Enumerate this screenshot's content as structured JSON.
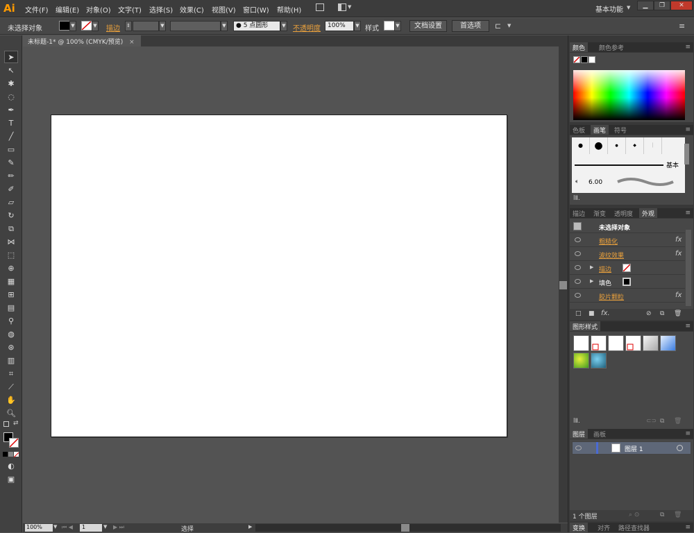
{
  "app": {
    "logo": "Ai",
    "workspace": "基本功能"
  },
  "menu": [
    "文件(F)",
    "编辑(E)",
    "对象(O)",
    "文字(T)",
    "选择(S)",
    "效果(C)",
    "视图(V)",
    "窗口(W)",
    "帮助(H)"
  ],
  "control_bar": {
    "selection_status": "未选择对象",
    "stroke_label": "描边",
    "brush_value": "● 5 点圆形",
    "opacity_label": "不透明度",
    "opacity_value": "100%",
    "style_label": "样式",
    "doc_setup_button": "文档设置",
    "preferences_button": "首选项"
  },
  "document": {
    "tab_title": "未标题-1* @ 100% (CMYK/预览)",
    "close_glyph": "×"
  },
  "status_bar": {
    "zoom": "100%",
    "artboard_num": "1",
    "tool_status": "选择"
  },
  "panels": {
    "color": {
      "tabs": [
        "颜色",
        "颜色参考"
      ]
    },
    "brushes": {
      "tabs": [
        "色板",
        "画笔",
        "符号"
      ],
      "basic_label": "基本",
      "brush_size": "6.00"
    },
    "appearance": {
      "tabs": [
        "描边",
        "渐变",
        "透明度",
        "外观"
      ],
      "title": "未选择对象",
      "rows": [
        {
          "label": "粗糙化",
          "fx": "fx"
        },
        {
          "label": "波纹效果",
          "fx": "fx"
        },
        {
          "label": "描边",
          "fx": ""
        },
        {
          "label": "填色",
          "fx": ""
        },
        {
          "label": "胶片颗粒",
          "fx": "fx"
        }
      ]
    },
    "graphic_styles": {
      "tabs": [
        "图形样式"
      ]
    },
    "layers": {
      "tabs": [
        "图层",
        "画板"
      ],
      "layer_name": "图层 1",
      "layer_count": "1 个图层"
    },
    "bottom": {
      "tabs": [
        "变换",
        "对齐",
        "路径查找器"
      ]
    }
  },
  "colors": {
    "accent_orange": "#e9a03c",
    "logo": "#ff9a00",
    "layer_color": "#4a6bd4"
  }
}
